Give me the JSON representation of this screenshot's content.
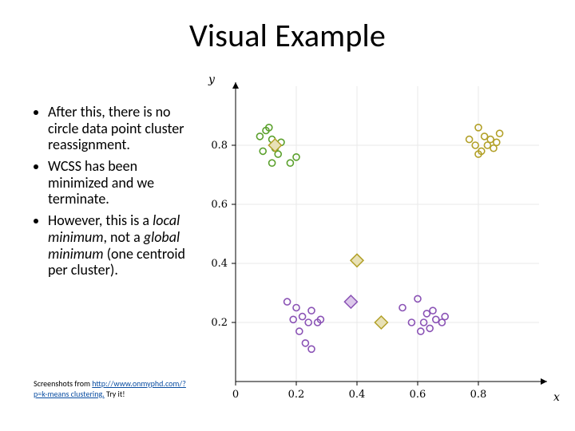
{
  "title": "Visual Example",
  "bullets": [
    {
      "pre": "After this, there is no circle data point cluster reassignment.",
      "em1": "",
      "mid": "",
      "em2": "",
      "post": ""
    },
    {
      "pre": "WCSS has been minimized and we terminate.",
      "em1": "",
      "mid": "",
      "em2": "",
      "post": ""
    },
    {
      "pre": "However, this is a ",
      "em1": "local minimum",
      "mid": ", not a ",
      "em2": "global minimum",
      "post": " (one centroid per cluster)."
    }
  ],
  "credit": {
    "pre": "Screenshots from ",
    "link": "http://www.onmyphd.com/?p=k-means clustering.",
    "post": "  Try it!"
  },
  "chart_data": {
    "type": "scatter",
    "title": "",
    "xlabel": "x",
    "ylabel": "y",
    "xlim": [
      0.0,
      1.0
    ],
    "ylim": [
      0.0,
      1.0
    ],
    "xticks": [
      0.0,
      0.2,
      0.4,
      0.6,
      0.8
    ],
    "yticks": [
      0.2,
      0.4,
      0.6,
      0.8
    ],
    "series": [
      {
        "name": "green-cluster",
        "marker": "circle",
        "color": "#5aa02c",
        "points": [
          [
            0.08,
            0.83
          ],
          [
            0.1,
            0.85
          ],
          [
            0.12,
            0.82
          ],
          [
            0.09,
            0.78
          ],
          [
            0.13,
            0.79
          ],
          [
            0.15,
            0.81
          ],
          [
            0.11,
            0.86
          ],
          [
            0.14,
            0.77
          ],
          [
            0.18,
            0.74
          ],
          [
            0.12,
            0.74
          ],
          [
            0.2,
            0.76
          ]
        ]
      },
      {
        "name": "olive-cluster",
        "marker": "circle",
        "color": "#b2a028",
        "points": [
          [
            0.8,
            0.86
          ],
          [
            0.82,
            0.83
          ],
          [
            0.84,
            0.82
          ],
          [
            0.79,
            0.8
          ],
          [
            0.83,
            0.8
          ],
          [
            0.86,
            0.81
          ],
          [
            0.77,
            0.82
          ],
          [
            0.81,
            0.78
          ],
          [
            0.85,
            0.79
          ],
          [
            0.8,
            0.77
          ],
          [
            0.87,
            0.84
          ]
        ]
      },
      {
        "name": "purple-cluster-left",
        "marker": "circle",
        "color": "#8a52b5",
        "points": [
          [
            0.17,
            0.27
          ],
          [
            0.2,
            0.25
          ],
          [
            0.22,
            0.22
          ],
          [
            0.19,
            0.21
          ],
          [
            0.24,
            0.2
          ],
          [
            0.25,
            0.24
          ],
          [
            0.28,
            0.21
          ],
          [
            0.21,
            0.17
          ],
          [
            0.23,
            0.13
          ],
          [
            0.25,
            0.11
          ],
          [
            0.27,
            0.2
          ]
        ]
      },
      {
        "name": "purple-cluster-right",
        "marker": "circle",
        "color": "#8a52b5",
        "points": [
          [
            0.55,
            0.25
          ],
          [
            0.6,
            0.28
          ],
          [
            0.63,
            0.23
          ],
          [
            0.58,
            0.2
          ],
          [
            0.62,
            0.2
          ],
          [
            0.66,
            0.21
          ],
          [
            0.69,
            0.22
          ],
          [
            0.64,
            0.18
          ],
          [
            0.61,
            0.17
          ],
          [
            0.68,
            0.2
          ],
          [
            0.65,
            0.24
          ]
        ]
      }
    ],
    "centroids": [
      {
        "name": "centroid-olive-1",
        "marker": "diamond",
        "color": "#b2a028",
        "x": 0.13,
        "y": 0.8
      },
      {
        "name": "centroid-olive-2",
        "marker": "diamond",
        "color": "#b2a028",
        "x": 0.4,
        "y": 0.41
      },
      {
        "name": "centroid-olive-3",
        "marker": "diamond",
        "color": "#b2a028",
        "x": 0.48,
        "y": 0.2
      },
      {
        "name": "centroid-purple-1",
        "marker": "diamond",
        "color": "#8a52b5",
        "x": 0.38,
        "y": 0.27
      }
    ]
  }
}
